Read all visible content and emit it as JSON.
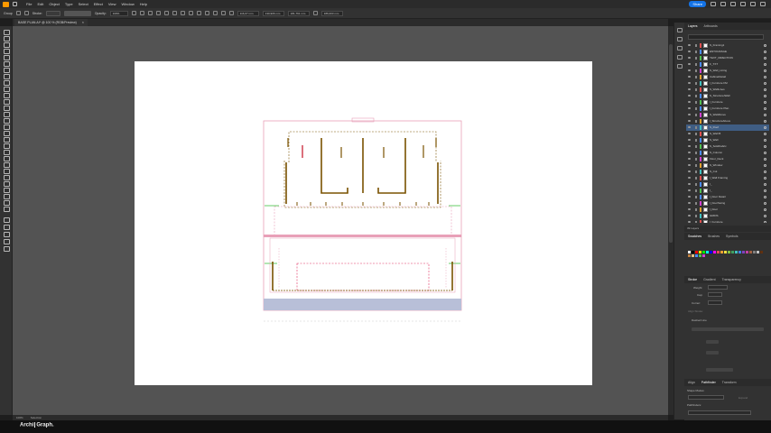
{
  "menubar": {
    "items": [
      "File",
      "Edit",
      "Object",
      "Type",
      "Select",
      "Effect",
      "View",
      "Window",
      "Help"
    ],
    "share_label": "Share"
  },
  "controlbar": {
    "left_label": "Group",
    "stroke_label": "Stroke:",
    "opacity_label": "Opacity:",
    "opacity_value": "100%",
    "x_value": "116,07 mm",
    "y_value": "130,906 mm",
    "w_value": "181,761 mm",
    "h_value": "186,003 mm"
  },
  "document_tab": {
    "title": "BASE PLAN.AI* @ 100 % (RGB/Preview)",
    "close": "×"
  },
  "statusbar": {
    "zoom": "100%",
    "tool": "Selection"
  },
  "brand": {
    "part1": "Archi",
    "part2": "Graph."
  },
  "panel_tabs": {
    "layers": "Layers",
    "artboards": "Artboards",
    "swatches": "Swatches",
    "brushes": "Brushes",
    "symbols": "Symbols",
    "stroke": "Stroke",
    "gradient": "Gradient",
    "transparency": "Transparency",
    "align": "Align",
    "pathfinder": "Pathfinder",
    "transform": "Transform"
  },
  "layers": [
    {
      "name": "S_Framing1",
      "color": "#e05050"
    },
    {
      "name": "ENTOURAGE",
      "color": "#4a8cff"
    },
    {
      "name": "TEXT_DIRECTION",
      "color": "#50c050"
    },
    {
      "name": "F_TXT",
      "color": "#4a8cff"
    },
    {
      "name": "S_Wall_Lining",
      "color": "#d040d0"
    },
    {
      "name": "CabinetDetail",
      "color": "#e0a030"
    },
    {
      "name": "I_Furniture FM",
      "color": "#40c0c0"
    },
    {
      "name": "S_WallLines",
      "color": "#e05050"
    },
    {
      "name": "S_Structure/Wall",
      "color": "#4a8cff"
    },
    {
      "name": "I_Furniture",
      "color": "#50c050"
    },
    {
      "name": "I_Furniture Plan",
      "color": "#4a8cff"
    },
    {
      "name": "S_WallAbove",
      "color": "#d040d0"
    },
    {
      "name": "I_StructureAbove",
      "color": "#e0a030"
    },
    {
      "name": "S_Roof",
      "color": "#40c0c0",
      "selected": true
    },
    {
      "name": "S_Wall B",
      "color": "#e05050"
    },
    {
      "name": "S_Wall",
      "color": "#4a8cff"
    },
    {
      "name": "S_SolidFabric",
      "color": "#50c050"
    },
    {
      "name": "S_Column",
      "color": "#4a8cff"
    },
    {
      "name": "Floor_Deck",
      "color": "#d040d0"
    },
    {
      "name": "S_Window",
      "color": "#e0a030"
    },
    {
      "name": "S_Cut",
      "color": "#40c0c0"
    },
    {
      "name": "I_Wall Framing",
      "color": "#e05050"
    },
    {
      "name": "I_",
      "color": "#4a8cff"
    },
    {
      "name": "I_",
      "color": "#50c050"
    },
    {
      "name": "I_Door Detail",
      "color": "#4a8cff"
    },
    {
      "name": "I_DoorSwing",
      "color": "#d040d0"
    },
    {
      "name": "I_Door",
      "color": "#e0a030"
    },
    {
      "name": "GRIDS",
      "color": "#40c0c0"
    },
    {
      "name": "I_Furniture",
      "color": "#e05050"
    }
  ],
  "layers_footer": "39 Layers",
  "stroke_panel": {
    "weight_label": "Weight:",
    "cap_label": "Cap:",
    "corner_label": "Corner:",
    "align_label": "Align Stroke:",
    "dashed_label": "Dashed Line"
  },
  "pathfinder_panel": {
    "shape_modes": "Shape Modes:",
    "pathfinders": "Pathfinders:",
    "expand": "Expand"
  },
  "colors": {
    "accent": "#1473e6",
    "wall": "#7a5200",
    "guide_red": "#e03060",
    "guide_green": "#40c040",
    "hatch": "#b8bfd8"
  }
}
